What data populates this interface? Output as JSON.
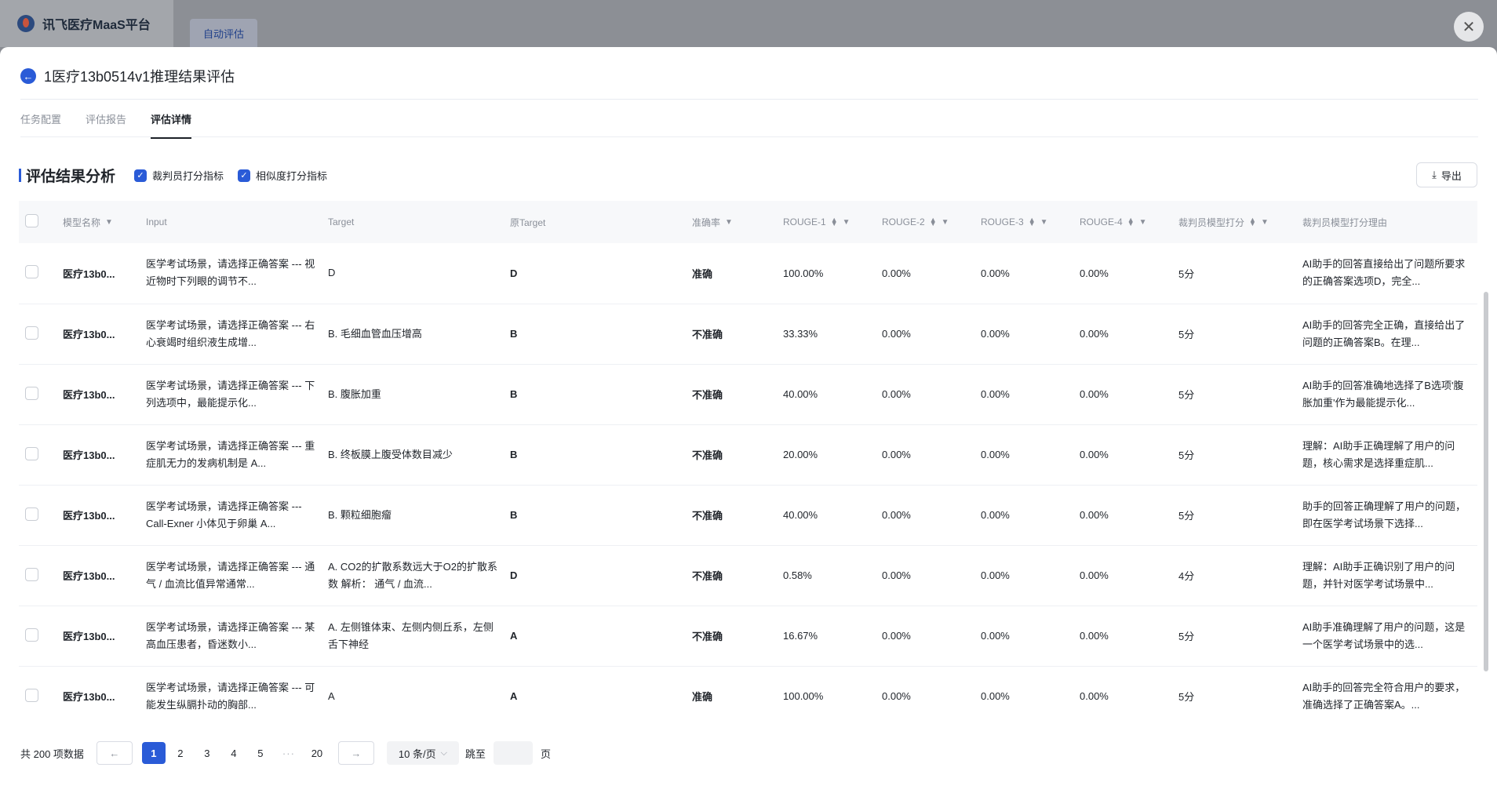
{
  "app": {
    "title": "讯飞医疗MaaS平台",
    "bg_tab": "自动评估",
    "close_symbol": "✕"
  },
  "drawer": {
    "back_symbol": "←",
    "title": "1医疗13b0514v1推理结果评估",
    "tabs": [
      {
        "label": "任务配置",
        "active": false
      },
      {
        "label": "评估报告",
        "active": false
      },
      {
        "label": "评估详情",
        "active": true
      }
    ],
    "section_title": "评估结果分析",
    "checkboxes": [
      {
        "label": "裁判员打分指标",
        "checked": true
      },
      {
        "label": "相似度打分指标",
        "checked": true
      }
    ],
    "export_label": "导出",
    "export_icon": "⤓"
  },
  "table": {
    "columns": [
      "模型名称",
      "Input",
      "Target",
      "原Target",
      "准确率",
      "ROUGE-1",
      "ROUGE-2",
      "ROUGE-3",
      "ROUGE-4",
      "裁判员模型打分",
      "裁判员模型打分理由"
    ],
    "rows": [
      {
        "model": "医疗13b0...",
        "input": "医学考试场景，请选择正确答案 --- 视近物时下列眼的调节不...",
        "target": "D",
        "orig_target": "D",
        "acc": "准确",
        "r1": "100.00%",
        "r2": "0.00%",
        "r3": "0.00%",
        "r4": "0.00%",
        "score": "5分",
        "reason": "AI助手的回答直接给出了问题所要求的正确答案选项D，完全..."
      },
      {
        "model": "医疗13b0...",
        "input": "医学考试场景，请选择正确答案 --- 右心衰竭时组织液生成增...",
        "target": "B. 毛细血管血压增高",
        "orig_target": "B",
        "acc": "不准确",
        "r1": "33.33%",
        "r2": "0.00%",
        "r3": "0.00%",
        "r4": "0.00%",
        "score": "5分",
        "reason": "AI助手的回答完全正确，直接给出了问题的正确答案B。在理..."
      },
      {
        "model": "医疗13b0...",
        "input": "医学考试场景，请选择正确答案 --- 下列选项中，最能提示化...",
        "target": "B. 腹胀加重",
        "orig_target": "B",
        "acc": "不准确",
        "r1": "40.00%",
        "r2": "0.00%",
        "r3": "0.00%",
        "r4": "0.00%",
        "score": "5分",
        "reason": "AI助手的回答准确地选择了B选项'腹胀加重'作为最能提示化..."
      },
      {
        "model": "医疗13b0...",
        "input": "医学考试场景，请选择正确答案 --- 重症肌无力的发病机制是 A...",
        "target": "B. 终板膜上腹受体数目减少",
        "orig_target": "B",
        "acc": "不准确",
        "r1": "20.00%",
        "r2": "0.00%",
        "r3": "0.00%",
        "r4": "0.00%",
        "score": "5分",
        "reason": "理解：AI助手正确理解了用户的问题，核心需求是选择重症肌..."
      },
      {
        "model": "医疗13b0...",
        "input": "医学考试场景，请选择正确答案 --- Call-Exner 小体见于卵巢 A...",
        "target": "B. 颗粒细胞瘤",
        "orig_target": "B",
        "acc": "不准确",
        "r1": "40.00%",
        "r2": "0.00%",
        "r3": "0.00%",
        "r4": "0.00%",
        "score": "5分",
        "reason": "助手的回答正确理解了用户的问题，即在医学考试场景下选择..."
      },
      {
        "model": "医疗13b0...",
        "input": "医学考试场景，请选择正确答案 --- 通气 / 血流比值异常通常...",
        "target": "A. CO2的扩散系数远大于O2的扩散系数 解析： 通气 / 血流...",
        "orig_target": "D",
        "acc": "不准确",
        "r1": "0.58%",
        "r2": "0.00%",
        "r3": "0.00%",
        "r4": "0.00%",
        "score": "4分",
        "reason": "理解：AI助手正确识别了用户的问题，并针对医学考试场景中..."
      },
      {
        "model": "医疗13b0...",
        "input": "医学考试场景，请选择正确答案 --- 某高血压患者，昏迷数小...",
        "target": "A. 左侧锥体束、左侧内侧丘系，左侧舌下神经",
        "orig_target": "A",
        "acc": "不准确",
        "r1": "16.67%",
        "r2": "0.00%",
        "r3": "0.00%",
        "r4": "0.00%",
        "score": "5分",
        "reason": "AI助手准确理解了用户的问题，这是一个医学考试场景中的选..."
      },
      {
        "model": "医疗13b0...",
        "input": "医学考试场景，请选择正确答案 --- 可能发生纵膈扑动的胸部...",
        "target": "A",
        "orig_target": "A",
        "acc": "准确",
        "r1": "100.00%",
        "r2": "0.00%",
        "r3": "0.00%",
        "r4": "0.00%",
        "score": "5分",
        "reason": "AI助手的回答完全符合用户的要求，准确选择了正确答案A。..."
      }
    ]
  },
  "pagination": {
    "total": "共 200 项数据",
    "prev": "←",
    "next": "→",
    "pages": [
      "1",
      "2",
      "3",
      "4",
      "5"
    ],
    "dots": "···",
    "last": "20",
    "page_size": "10 条/页",
    "page_size_caret": "⌵",
    "jump_label": "跳至",
    "jump_value": "",
    "page_suffix": "页"
  }
}
